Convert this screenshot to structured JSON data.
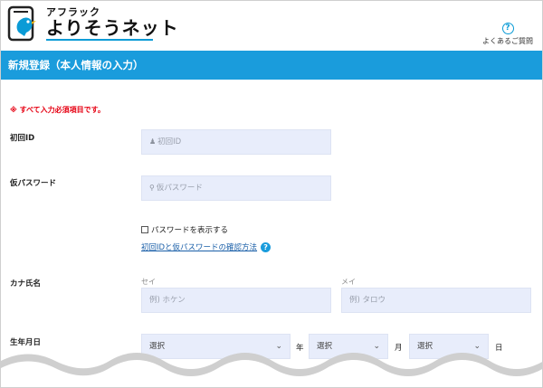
{
  "header": {
    "logo_sub": "アフラック",
    "logo_main": "よりそうネット",
    "faq_label": "よくあるご質問",
    "faq_icon": "question-circle-icon"
  },
  "title_bar": {
    "text": "新規登録（本人情報の入力）"
  },
  "form": {
    "notice": "※ すべて入力必須項目です。",
    "initial_id": {
      "label": "初回ID",
      "placeholder": "初回ID",
      "icon": "person-icon"
    },
    "temp_password": {
      "label": "仮パスワード",
      "placeholder": "仮パスワード",
      "icon": "key-icon"
    },
    "show_password": "パスワードを表示する",
    "confirm_link": "初回IDと仮パスワードの確認方法",
    "kana_name": {
      "label": "カナ氏名",
      "sei_label": "セイ",
      "sei_placeholder": "例) ホケン",
      "mei_label": "メイ",
      "mei_placeholder": "例) タロウ"
    },
    "birthdate": {
      "label": "生年月日",
      "year_value": "選択",
      "year_unit": "年",
      "month_value": "選択",
      "month_unit": "月",
      "day_value": "選択",
      "day_unit": "日"
    }
  },
  "colors": {
    "accent": "#1a9cdc",
    "required": "#e60012",
    "input_bg": "#e8edfb"
  }
}
